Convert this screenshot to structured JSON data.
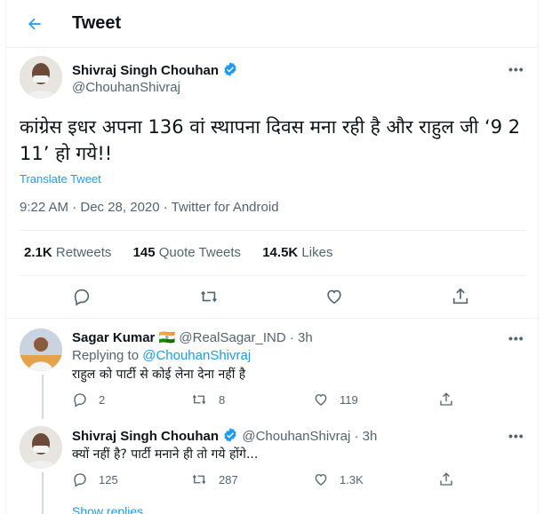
{
  "header": {
    "title": "Tweet"
  },
  "main_tweet": {
    "author_name": "Shivraj Singh Chouhan",
    "handle": "@ChouhanShivraj",
    "text": "कांग्रेस इधर अपना 136 वां स्थापना दिवस मना रही है और राहुल जी ‘9 2 11’ हो गये!!",
    "translate": "Translate Tweet",
    "meta": "9:22 AM · Dec 28, 2020 · Twitter for Android",
    "stats": {
      "retweets_count": "2.1K",
      "retweets_label": "Retweets",
      "quotes_count": "145",
      "quotes_label": "Quote Tweets",
      "likes_count": "14.5K",
      "likes_label": "Likes"
    }
  },
  "replies": [
    {
      "author_name": "Sagar Kumar",
      "flag": "🇮🇳",
      "handle": "@RealSagar_IND",
      "time": "· 3h",
      "replying_prefix": "Replying to",
      "replying_handle": "@ChouhanShivraj",
      "text": "राहुल को पार्टी से कोई लेना देना नहीं है",
      "reply_count": "2",
      "retweet_count": "8",
      "like_count": "119"
    },
    {
      "author_name": "Shivraj Singh Chouhan",
      "handle": "@ChouhanShivraj",
      "time": "· 3h",
      "text": "क्यों नहीं है? पार्टी मनाने ही तो गये होंगे...",
      "reply_count": "125",
      "retweet_count": "287",
      "like_count": "1.3K"
    }
  ],
  "show_replies": "Show replies",
  "colors": {
    "accent": "#1d9bf0",
    "text": "#0f1419",
    "muted": "#536471"
  }
}
